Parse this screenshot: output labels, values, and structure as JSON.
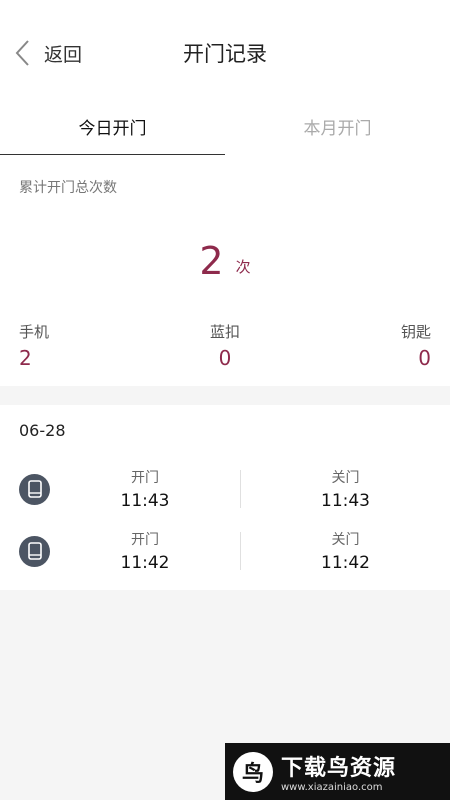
{
  "header": {
    "back_label": "返回",
    "title": "开门记录"
  },
  "tabs": [
    {
      "label": "今日开门",
      "active": true
    },
    {
      "label": "本月开门",
      "active": false
    }
  ],
  "summary": {
    "label": "累计开门总次数",
    "total": "2",
    "unit": "次",
    "stats": [
      {
        "label": "手机",
        "value": "2"
      },
      {
        "label": "蓝扣",
        "value": "0"
      },
      {
        "label": "钥匙",
        "value": "0"
      }
    ]
  },
  "records": {
    "date": "06-28",
    "rows": [
      {
        "open_label": "开门",
        "open_time": "11:43",
        "close_label": "关门",
        "close_time": "11:43",
        "icon": "phone-icon"
      },
      {
        "open_label": "开门",
        "open_time": "11:42",
        "close_label": "关门",
        "close_time": "11:42",
        "icon": "phone-icon"
      }
    ]
  },
  "watermark": {
    "logo_char": "鸟",
    "title": "下载鸟资源",
    "url": "www.xiazainiao.com"
  },
  "colors": {
    "accent": "#8e2a4c",
    "icon_bg": "#4c5563"
  }
}
